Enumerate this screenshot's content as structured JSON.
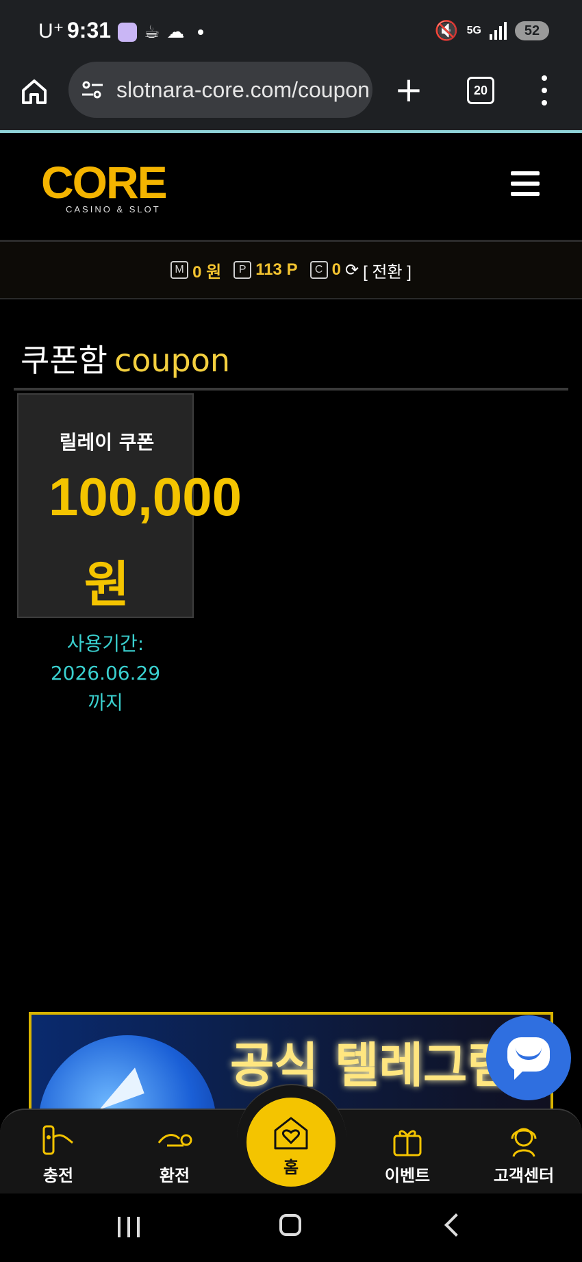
{
  "status_bar": {
    "carrier": "U⁺",
    "time": "9:31",
    "network": "5G",
    "battery": "52"
  },
  "browser": {
    "url": "slotnara-core.com/coupon",
    "tab_count": "20",
    "new_tab": "+"
  },
  "site": {
    "logo_main": "CORE",
    "logo_sub": "CASINO & SLOT"
  },
  "balance": {
    "money_badge": "M",
    "money": "0 원",
    "point_badge": "P",
    "points": "113 P",
    "casino_badge": "C",
    "casino": "0",
    "switch_label": "[ 전환 ]"
  },
  "page": {
    "title_ko": "쿠폰함",
    "title_en": "coupon"
  },
  "coupons": [
    {
      "name": "릴레이 쿠폰",
      "amount": "100,000",
      "unit": "원",
      "expiry_label": "사용기간:",
      "expiry_date": "2026.06.29",
      "expiry_suffix": "까지"
    }
  ],
  "banner": {
    "text": "공식 텔레그램"
  },
  "bottom_nav": {
    "items": [
      {
        "label": "충전"
      },
      {
        "label": "환전"
      },
      {
        "label": "홈"
      },
      {
        "label": "이벤트"
      },
      {
        "label": "고객센터"
      }
    ]
  },
  "colors": {
    "accent_gold": "#f4c400",
    "expiry_cyan": "#3ad0cf",
    "chat_blue": "#2f6fe0"
  }
}
